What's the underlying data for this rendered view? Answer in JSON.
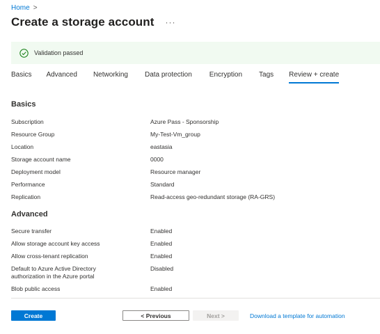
{
  "breadcrumb": {
    "home": "Home",
    "separator": ">"
  },
  "page": {
    "title": "Create a storage account",
    "more": "···"
  },
  "validation": {
    "text": "Validation passed",
    "icon": "check-circle-icon",
    "color": "#107c10"
  },
  "tabs": [
    {
      "label": "Basics",
      "active": false
    },
    {
      "label": "Advanced",
      "active": false
    },
    {
      "label": "Networking",
      "active": false
    },
    {
      "label": "Data protection",
      "active": false
    },
    {
      "label": "Encryption",
      "active": false
    },
    {
      "label": "Tags",
      "active": false
    },
    {
      "label": "Review + create",
      "active": true
    }
  ],
  "basics": {
    "title": "Basics",
    "rows": [
      {
        "label": "Subscription",
        "value": "Azure Pass - Sponsorship"
      },
      {
        "label": "Resource Group",
        "value": "My-Test-Vm_group"
      },
      {
        "label": "Location",
        "value": "eastasia"
      },
      {
        "label": "Storage account name",
        "value": "0000"
      },
      {
        "label": "Deployment model",
        "value": "Resource manager"
      },
      {
        "label": "Performance",
        "value": "Standard"
      },
      {
        "label": "Replication",
        "value": "Read-access geo-redundant storage (RA-GRS)"
      }
    ]
  },
  "advanced": {
    "title": "Advanced",
    "rows": [
      {
        "label": "Secure transfer",
        "value": "Enabled"
      },
      {
        "label": "Allow storage account key access",
        "value": "Enabled"
      },
      {
        "label": "Allow cross-tenant replication",
        "value": "Enabled"
      },
      {
        "label": "Default to Azure Active Directory authorization in the Azure portal",
        "value": "Disabled"
      },
      {
        "label": "Blob public access",
        "value": "Enabled"
      }
    ]
  },
  "footer": {
    "create": "Create",
    "previous": "< Previous",
    "next": "Next >",
    "download": "Download a template for automation"
  },
  "colors": {
    "accent": "#0078d4",
    "success_bg": "#f1faf1"
  }
}
